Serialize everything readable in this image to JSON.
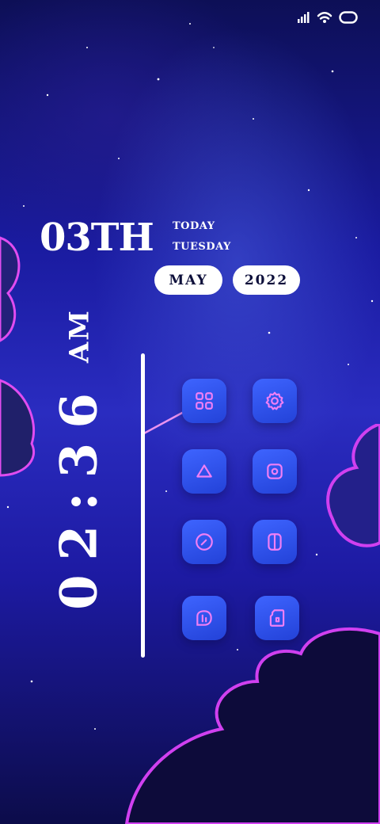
{
  "status_bar": {
    "icons": [
      "signal-icon",
      "wifi-icon",
      "battery-icon"
    ]
  },
  "date": {
    "day": "03TH",
    "today_label": "TODAY",
    "weekday": "TUESDAY",
    "month": "MAY",
    "year": "2022"
  },
  "clock": {
    "time": "02:36",
    "ampm": "AM"
  },
  "apps": [
    {
      "icon": "grid-icon"
    },
    {
      "icon": "settings-icon"
    },
    {
      "icon": "triangle-icon"
    },
    {
      "icon": "camera-icon"
    },
    {
      "icon": "clock-icon"
    },
    {
      "icon": "split-screen-icon"
    },
    {
      "icon": "chart-icon"
    },
    {
      "icon": "sd-card-icon"
    }
  ],
  "colors": {
    "accent": "#f07ff5",
    "tile": "#3050ee",
    "background": "#1a1ba0"
  }
}
